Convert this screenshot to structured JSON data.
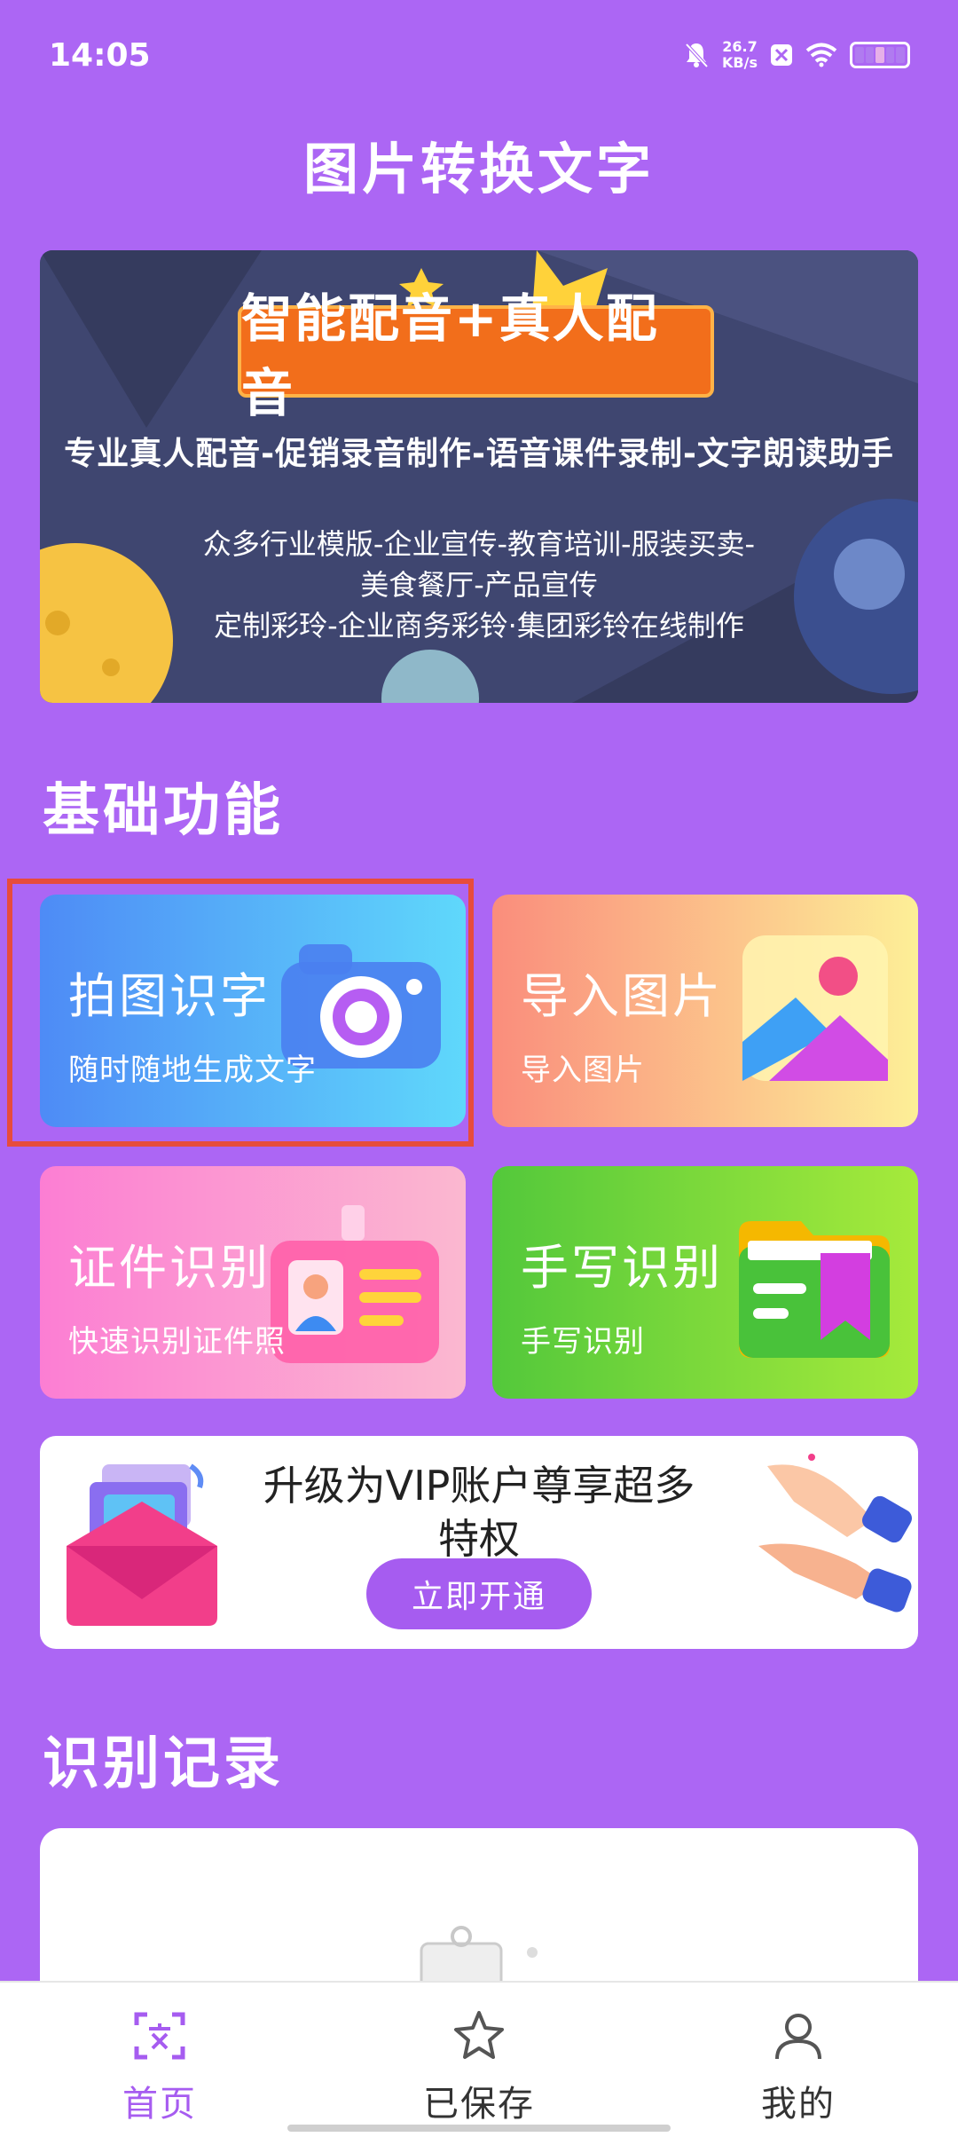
{
  "status_bar": {
    "time": "14:05",
    "speed_value": "26.7",
    "speed_unit": "KB/s"
  },
  "header": {
    "title": "图片转换文字"
  },
  "banner": {
    "headline": "智能配音+真人配音",
    "line1": "专业真人配音-促销录音制作-语音课件录制-文字朗读助手",
    "line2": "众多行业模版-企业宣传-教育培训-服装买卖-",
    "line3": "美食餐厅-产品宣传",
    "line4": "定制彩玲-企业商务彩铃·集团彩铃在线制作"
  },
  "sections": {
    "basic": "基础功能",
    "records": "识别记录"
  },
  "features": [
    {
      "title": "拍图识字",
      "subtitle": "随时随地生成文字",
      "icon": "camera-icon"
    },
    {
      "title": "导入图片",
      "subtitle": "导入图片",
      "icon": "image-icon"
    },
    {
      "title": "证件识别",
      "subtitle": "快速识别证件照",
      "icon": "id-card-icon"
    },
    {
      "title": "手写识别",
      "subtitle": "手写识别",
      "icon": "folder-bookmark-icon"
    }
  ],
  "vip": {
    "text": "升级为VIP账户尊享超多特权",
    "button": "立即开通"
  },
  "bottom_nav": [
    {
      "label": "首页",
      "icon": "text-scan-icon",
      "active": true
    },
    {
      "label": "已保存",
      "icon": "star-icon",
      "active": false
    },
    {
      "label": "我的",
      "icon": "user-icon",
      "active": false
    }
  ],
  "colors": {
    "background": "#ac66f4",
    "accent": "#a65cf0",
    "highlight": "#e74c3c"
  }
}
